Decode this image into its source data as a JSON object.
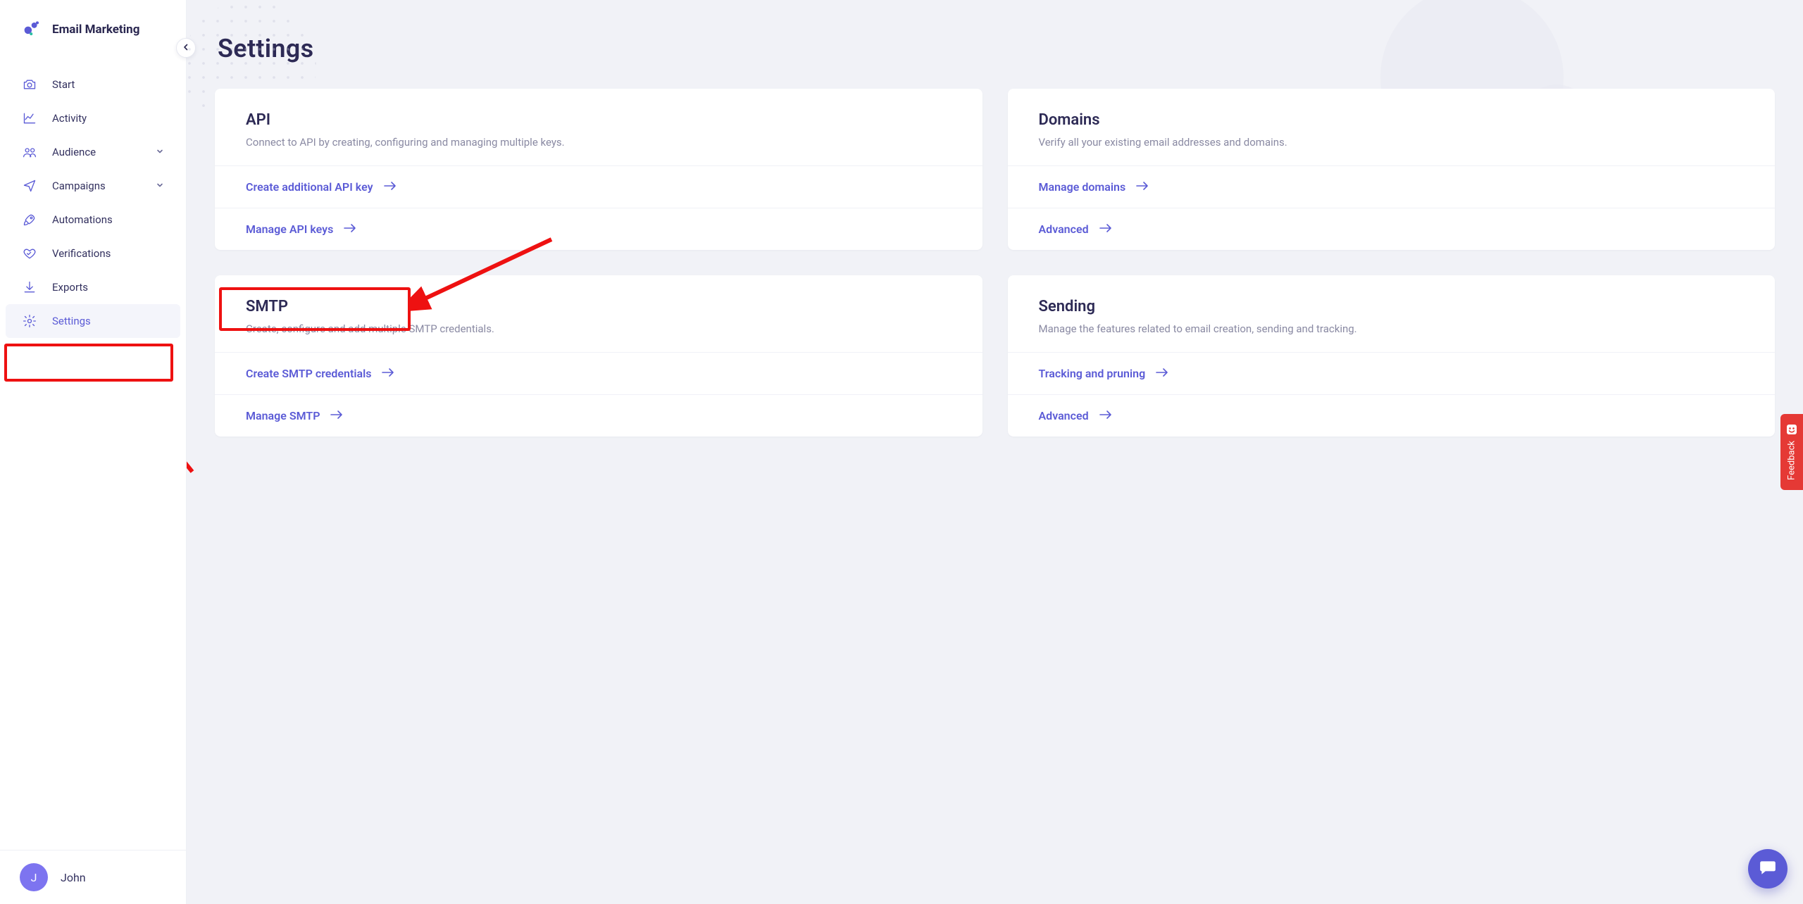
{
  "brand": "Email Marketing",
  "page_title": "Settings",
  "user": {
    "initial": "J",
    "name": "John"
  },
  "sidebar": {
    "items": [
      {
        "icon": "camera-icon",
        "label": "Start",
        "expandable": false,
        "active": false
      },
      {
        "icon": "activity-icon",
        "label": "Activity",
        "expandable": false,
        "active": false
      },
      {
        "icon": "people-icon",
        "label": "Audience",
        "expandable": true,
        "active": false
      },
      {
        "icon": "send-icon",
        "label": "Campaigns",
        "expandable": true,
        "active": false
      },
      {
        "icon": "rocket-icon",
        "label": "Automations",
        "expandable": false,
        "active": false
      },
      {
        "icon": "heart-icon",
        "label": "Verifications",
        "expandable": false,
        "active": false
      },
      {
        "icon": "download-icon",
        "label": "Exports",
        "expandable": false,
        "active": false
      },
      {
        "icon": "gear-icon",
        "label": "Settings",
        "expandable": false,
        "active": true
      }
    ]
  },
  "cards": [
    {
      "title": "API",
      "desc": "Connect to API by creating, configuring and managing multiple keys.",
      "links": [
        {
          "label": "Create additional API key"
        },
        {
          "label": "Manage API keys"
        }
      ]
    },
    {
      "title": "Domains",
      "desc": "Verify all your existing email addresses and domains.",
      "links": [
        {
          "label": "Manage domains"
        },
        {
          "label": "Advanced"
        }
      ]
    },
    {
      "title": "SMTP",
      "desc": "Create, configure and add multiple SMTP credentials.",
      "links": [
        {
          "label": "Create SMTP credentials"
        },
        {
          "label": "Manage SMTP"
        }
      ]
    },
    {
      "title": "Sending",
      "desc": "Manage the features related to email creation, sending and tracking.",
      "links": [
        {
          "label": "Tracking and pruning"
        },
        {
          "label": "Advanced"
        }
      ]
    }
  ],
  "feedback_label": "Feedback",
  "annotations": {
    "highlight_sidebar_settings": true,
    "highlight_manage_api_keys": true
  }
}
